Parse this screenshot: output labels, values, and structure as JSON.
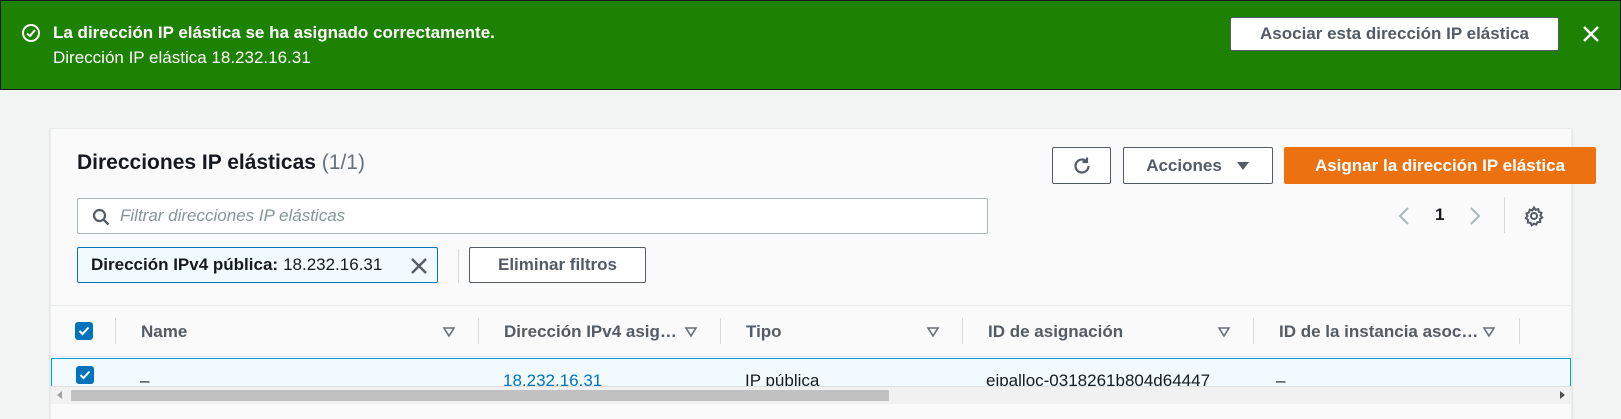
{
  "flash": {
    "type": "success",
    "icon": "check-circle-icon",
    "title": "La dirección IP elástica se ha asignado correctamente.",
    "message": "Dirección IP elástica 18.232.16.31",
    "action_label": "Asociar esta dirección IP elástica",
    "color": "#1d8102"
  },
  "header": {
    "title": "Direcciones IP elásticas",
    "count": "(1/1)",
    "actions_label": "Acciones",
    "primary_label": "Asignar la dirección IP elástica",
    "primary_color": "#ec7211"
  },
  "search": {
    "placeholder": "Filtrar direcciones IP elásticas",
    "value": ""
  },
  "pagination": {
    "current_page": "1"
  },
  "filter_token": {
    "key": "Dirección IPv4 pública:",
    "value": "18.232.16.31"
  },
  "clear_filters_label": "Eliminar filtros",
  "table": {
    "columns": [
      "Name",
      "Dirección IPv4 asig…",
      "Tipo",
      "ID de asignación",
      "ID de la instancia asoc…"
    ],
    "rows": [
      {
        "selected": true,
        "name": "–",
        "ipv4": "18.232.16.31",
        "type": "IP pública",
        "allocation_id": "eipalloc-0318261b804d64447",
        "instance_id": "–"
      }
    ]
  },
  "accent_color": "#0073bb"
}
